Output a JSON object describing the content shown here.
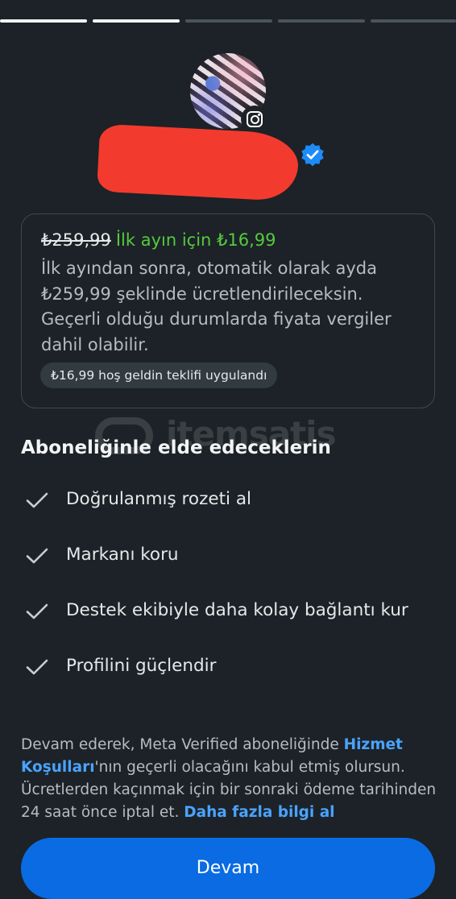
{
  "colors": {
    "background": "#1c2227",
    "accent_blue": "#0a6be3",
    "link_blue": "#4aa3ff",
    "promo_green": "#56c93f",
    "redaction_red": "#f23b2e"
  },
  "progress": {
    "segments": 5,
    "completed": 2
  },
  "profile": {
    "avatar_icon": "profile-photo",
    "badge_icon": "instagram-icon",
    "verified_icon": "verified-badge-icon"
  },
  "offer": {
    "old_price": "₺259,99",
    "promo_text": "İlk ayın için ₺16,99",
    "description": "İlk ayından sonra, otomatik olarak ayda ₺259,99 şeklinde ücretlendirileceksin. Geçerli olduğu durumlarda fiyata vergiler dahil olabilir.",
    "applied_badge": "₺16,99 hoş geldin teklifi uygulandı"
  },
  "watermark": {
    "text": "itemsatis"
  },
  "benefits": {
    "title": "Aboneliğinle elde edeceklerin",
    "items": [
      {
        "label": "Doğrulanmış rozeti al",
        "icon": "check-icon"
      },
      {
        "label": "Markanı koru",
        "icon": "check-icon"
      },
      {
        "label": "Destek ekibiyle daha kolay bağlantı kur",
        "icon": "check-icon"
      },
      {
        "label": "Profilini güçlendir",
        "icon": "check-icon"
      }
    ]
  },
  "terms": {
    "text_before": "Devam ederek, Meta Verified aboneliğinde ",
    "terms_link": "Hizmet Koşulları",
    "text_middle": "'nın geçerli olacağını kabul etmiş olursun. Ücretlerden kaçınmak için bir sonraki ödeme tarihinden 24 saat önce iptal et. ",
    "more_link": "Daha fazla bilgi al"
  },
  "continue_button": {
    "label": "Devam"
  }
}
